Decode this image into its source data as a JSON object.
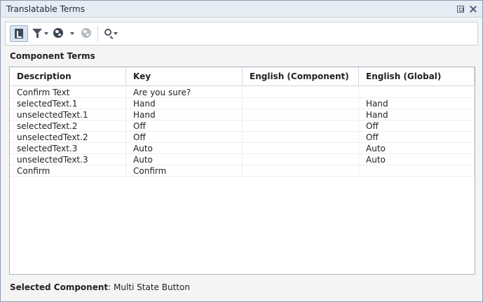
{
  "window": {
    "title": "Translatable Terms"
  },
  "toolbar": {
    "search_value": "",
    "icons": [
      "tree-view-icon",
      "filter-icon",
      "globe-icon",
      "globe-disabled-icon",
      "search-icon"
    ]
  },
  "section": {
    "title": "Component Terms"
  },
  "table": {
    "columns": [
      "Description",
      "Key",
      "English (Component)",
      "English (Global)"
    ],
    "rows": [
      [
        "Confirm Text",
        "Are you sure?",
        "",
        ""
      ],
      [
        "selectedText.1",
        "Hand",
        "",
        "Hand"
      ],
      [
        "unselectedText.1",
        "Hand",
        "",
        "Hand"
      ],
      [
        "selectedText.2",
        "Off",
        "",
        "Off"
      ],
      [
        "unselectedText.2",
        "Off",
        "",
        "Off"
      ],
      [
        "selectedText.3",
        "Auto",
        "",
        "Auto"
      ],
      [
        "unselectedText.3",
        "Auto",
        "",
        "Auto"
      ],
      [
        "Confirm",
        "Confirm",
        "",
        ""
      ]
    ]
  },
  "footer": {
    "label": "Selected Component",
    "value": "Multi State Button"
  }
}
